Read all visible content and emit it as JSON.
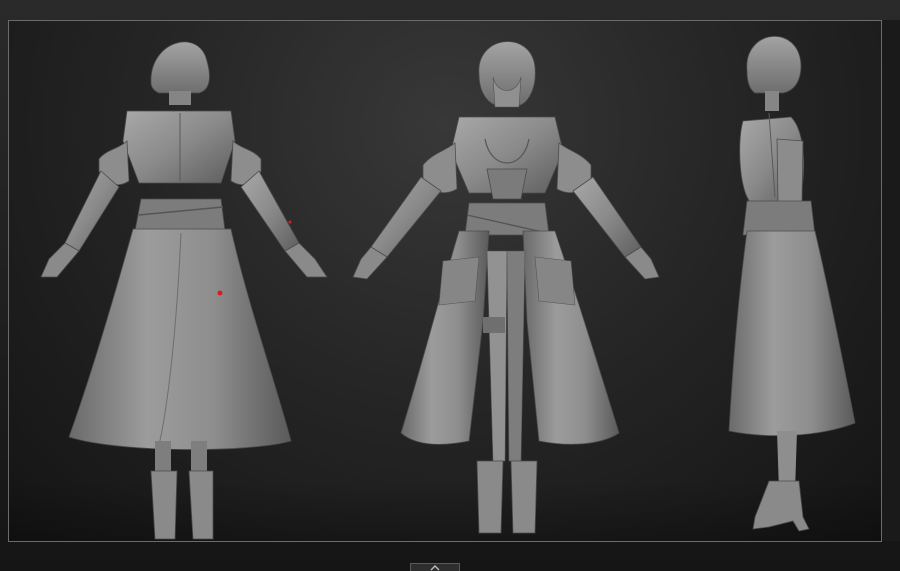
{
  "viewport": {
    "background_top": "#383838",
    "background_bottom": "#141414",
    "border_color": "#6b6b6b"
  },
  "models": [
    {
      "view": "back",
      "material": "#8f8f8f",
      "marker": "#d21f1f"
    },
    {
      "view": "front",
      "material": "#8f8f8f"
    },
    {
      "view": "side",
      "material": "#8f8f8f"
    }
  ],
  "bottom_handle": {
    "icon": "chevron-up-icon"
  }
}
